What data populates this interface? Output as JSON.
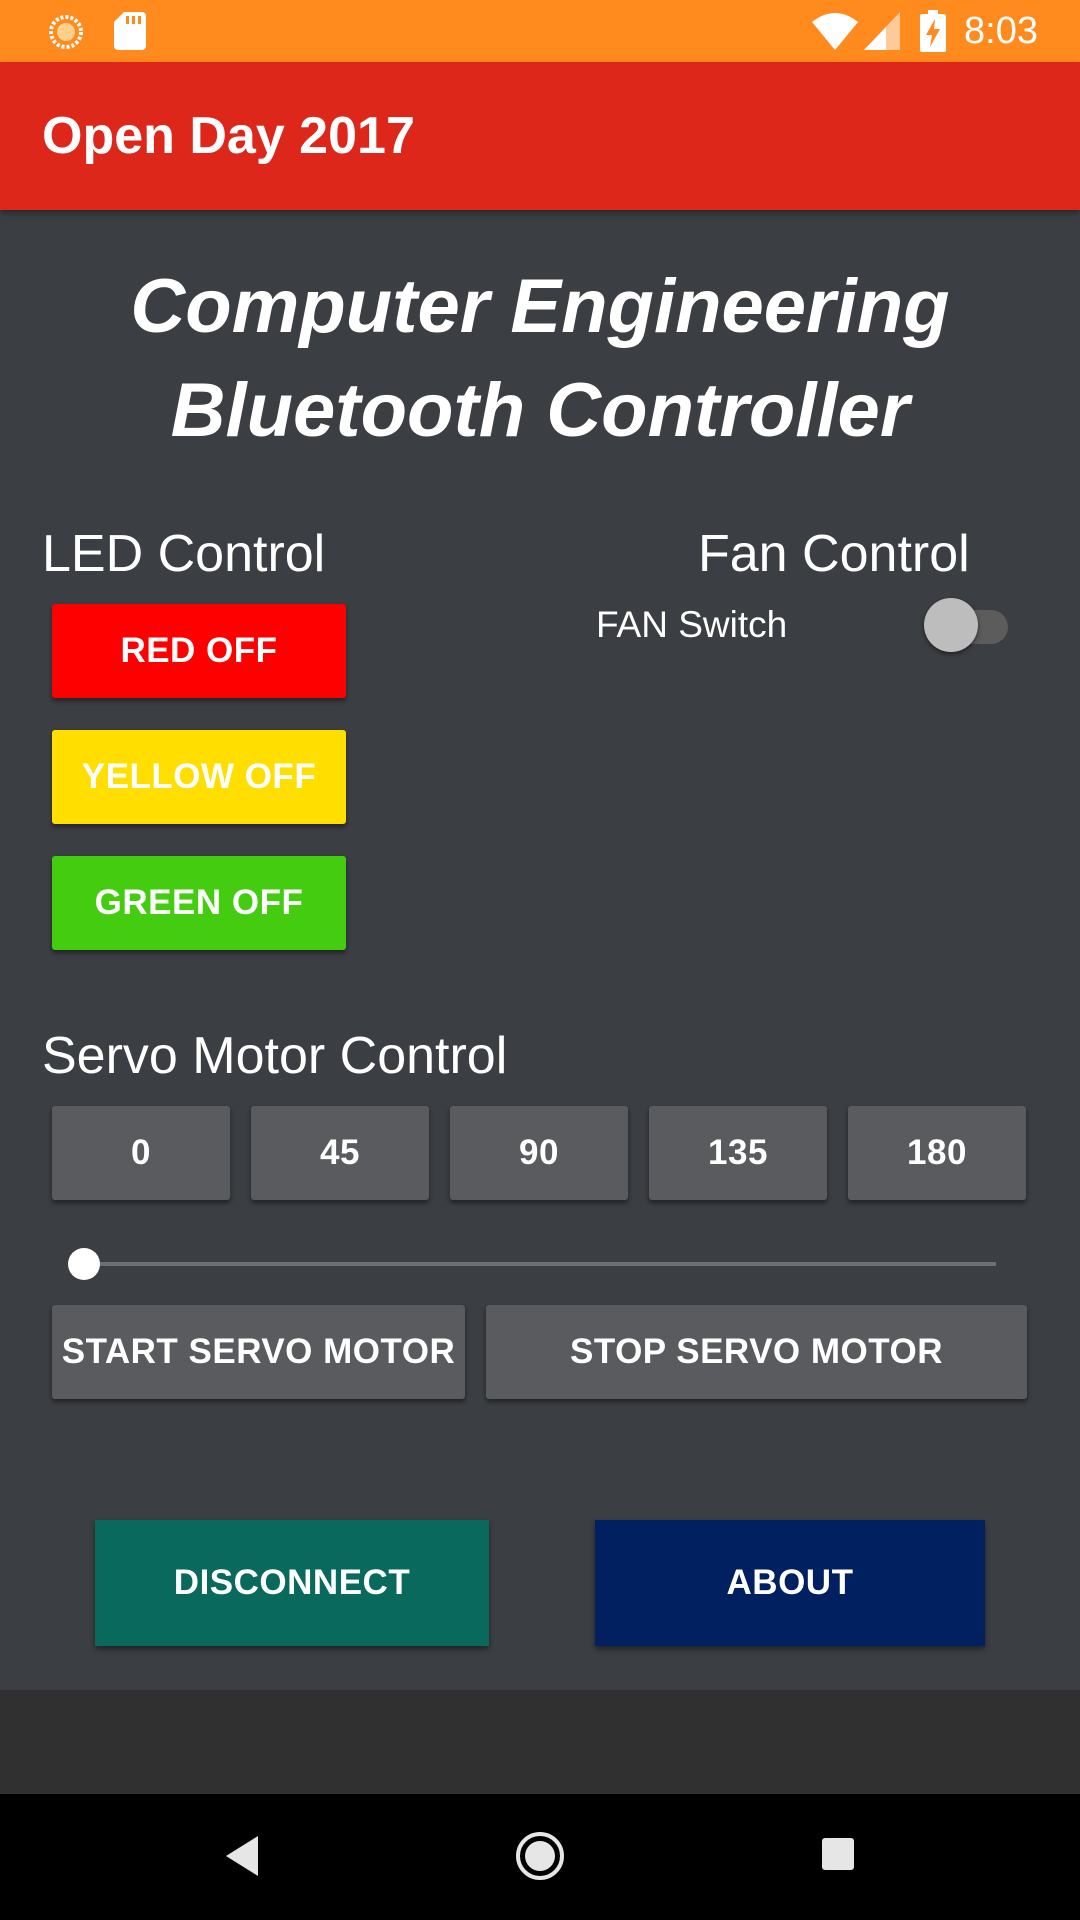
{
  "status_bar": {
    "time": "8:03",
    "icons": [
      "notification-sun-icon",
      "sd-card-icon",
      "wifi-icon",
      "signal-icon",
      "battery-charging-icon"
    ]
  },
  "app_bar": {
    "title": "Open Day 2017"
  },
  "headline": {
    "line1": "Computer Engineering",
    "line2": "Bluetooth Controller"
  },
  "led_control": {
    "title": "LED Control",
    "buttons": [
      {
        "label": "RED OFF",
        "color": "#ff0000"
      },
      {
        "label": "YELLOW OFF",
        "color": "#ffde00"
      },
      {
        "label": "GREEN OFF",
        "color": "#44cc11"
      }
    ]
  },
  "fan_control": {
    "title": "Fan Control",
    "switch_label": "FAN Switch",
    "switch_on": false
  },
  "servo_control": {
    "title": "Servo Motor Control",
    "angle_buttons": [
      "0",
      "45",
      "90",
      "135",
      "180"
    ],
    "slider_value": 0,
    "start_label": "START SERVO MOTOR",
    "stop_label": "STOP SERVO MOTOR"
  },
  "actions": {
    "disconnect_label": "DISCONNECT",
    "disconnect_color": "#08695c",
    "about_label": "ABOUT",
    "about_color": "#002060"
  },
  "nav_bar": {
    "icons": [
      "back-icon",
      "home-icon",
      "recents-icon"
    ]
  }
}
